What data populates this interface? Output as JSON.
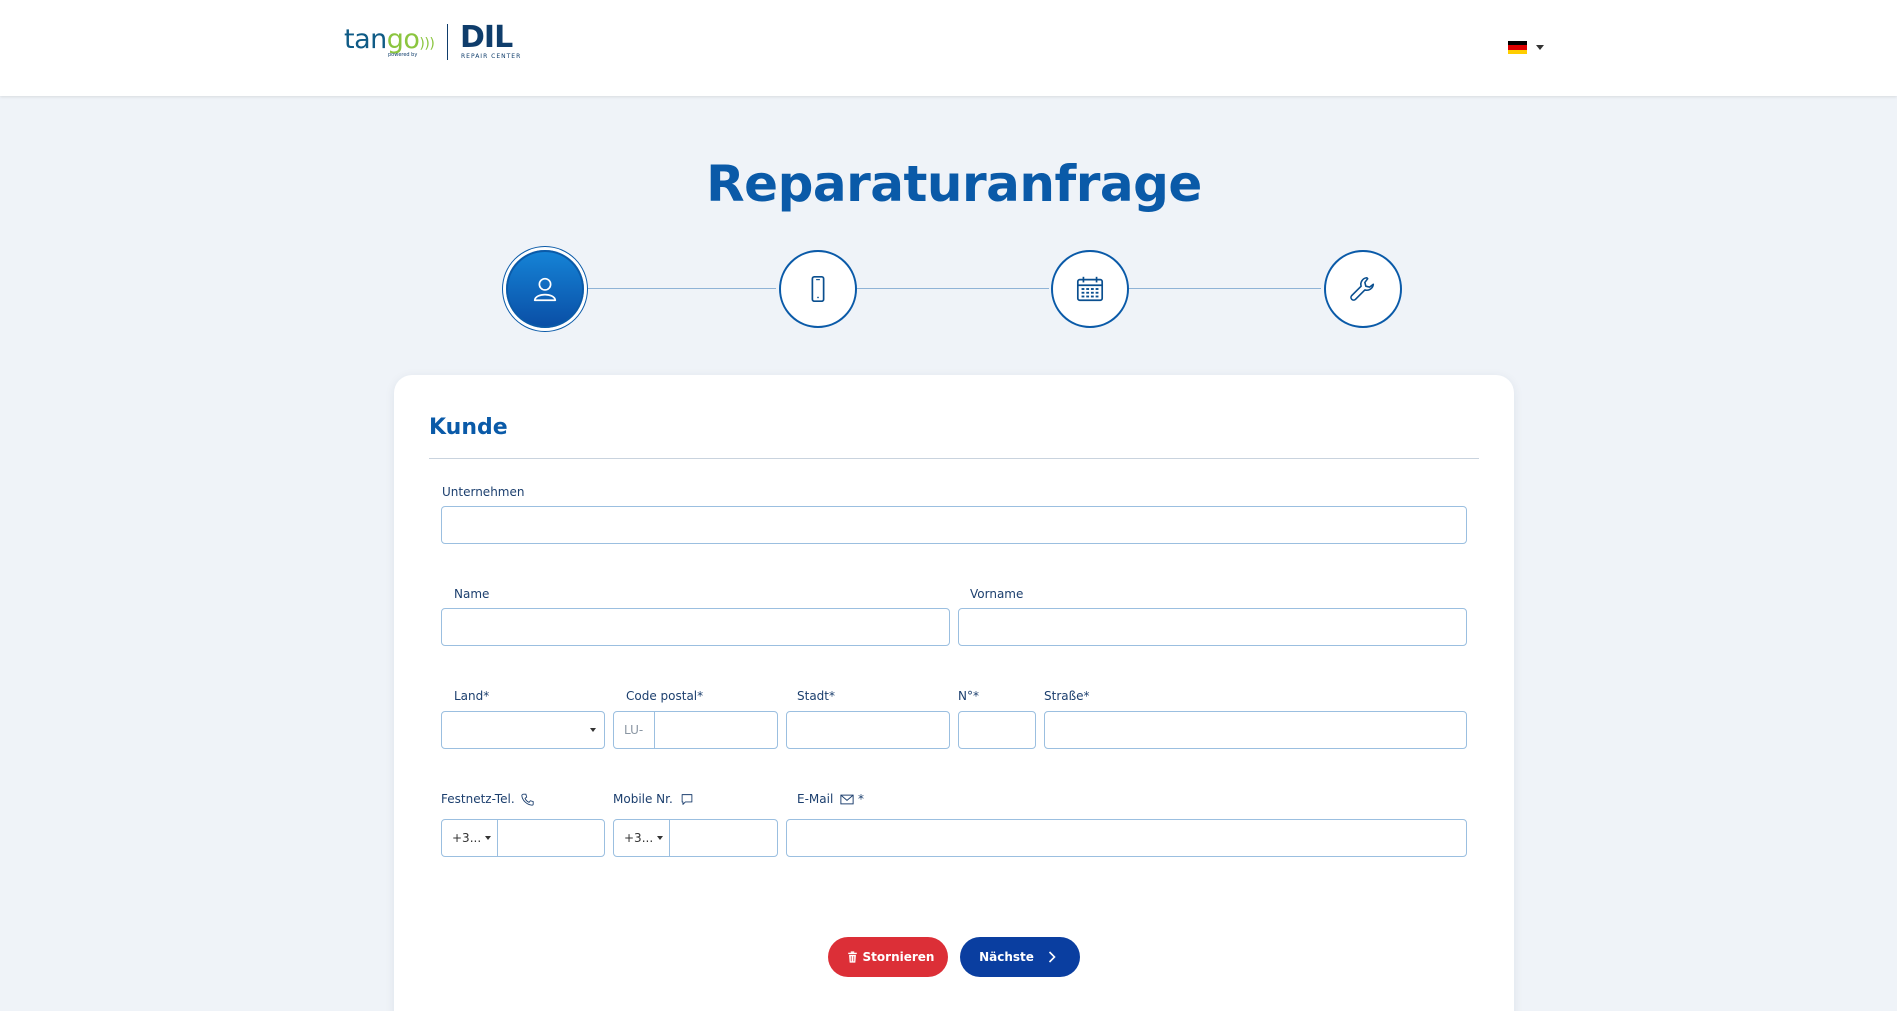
{
  "header": {
    "logo_tango_a": "tan",
    "logo_tango_b": "go",
    "logo_tango_waves": ")))",
    "logo_powered": "powered by",
    "logo_dil": "DIL",
    "logo_repair": "REPAIR CENTER",
    "language": "de"
  },
  "page": {
    "title": "Reparaturanfrage"
  },
  "stepper": {
    "steps": [
      {
        "icon": "user-icon",
        "active": true
      },
      {
        "icon": "phone-icon",
        "active": false
      },
      {
        "icon": "calendar-icon",
        "active": false
      },
      {
        "icon": "wrench-icon",
        "active": false
      }
    ]
  },
  "form": {
    "section_title": "Kunde",
    "company": {
      "label": "Unternehmen",
      "value": ""
    },
    "name": {
      "label": "Name",
      "value": ""
    },
    "firstname": {
      "label": "Vorname",
      "value": ""
    },
    "country": {
      "label": "Land*",
      "value": ""
    },
    "postal": {
      "label": "Code postal*",
      "prefix": "LU-",
      "value": ""
    },
    "city": {
      "label": "Stadt*",
      "value": ""
    },
    "number": {
      "label": "N°*",
      "value": ""
    },
    "street": {
      "label": "Straße*",
      "value": ""
    },
    "landline": {
      "label": "Festnetz-Tel.",
      "code": "+3...",
      "value": ""
    },
    "mobile": {
      "label": "Mobile Nr.",
      "code": "+3...",
      "value": ""
    },
    "email": {
      "label": "E-Mail",
      "required_mark": "*",
      "value": ""
    }
  },
  "actions": {
    "cancel_label": "Stornieren",
    "next_label": "Nächste"
  },
  "colors": {
    "brand_blue": "#0a5aa8",
    "cancel_red": "#dc2f37",
    "next_blue": "#0a3ea0",
    "background": "#eff3f8"
  }
}
